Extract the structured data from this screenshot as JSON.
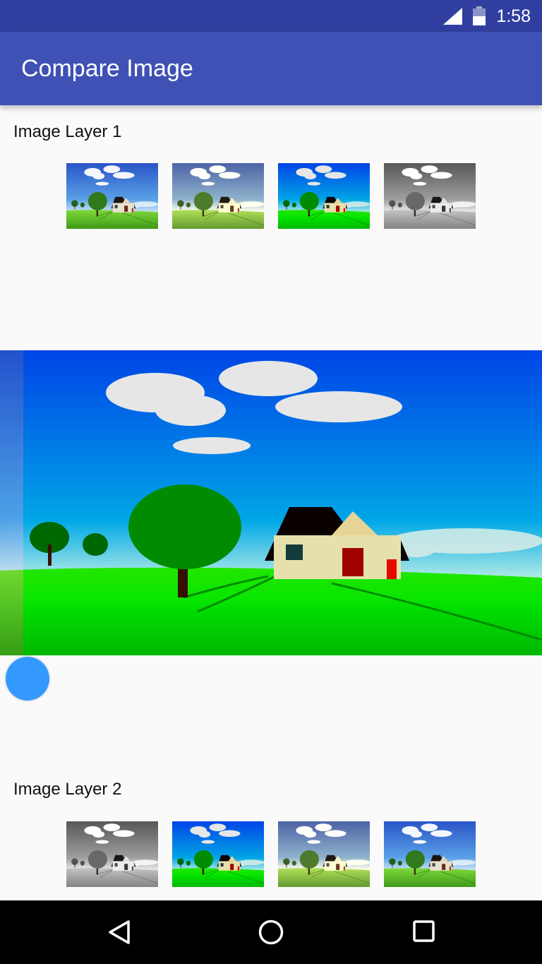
{
  "status_bar": {
    "time": "1:58",
    "icons": [
      "signal-icon",
      "battery-icon"
    ]
  },
  "app_bar": {
    "title": "Compare Image"
  },
  "layer1": {
    "label": "Image Layer 1",
    "thumbnails": [
      "normal",
      "vintage",
      "vivid",
      "grayscale"
    ]
  },
  "layer2": {
    "label": "Image Layer 2",
    "thumbnails": [
      "grayscale",
      "vivid",
      "vintage",
      "normal"
    ]
  },
  "compare": {
    "top_layer": "vivid",
    "bottom_layer": "normal",
    "slider_percent": 4.3
  },
  "colors": {
    "status_bar": "#303f9f",
    "app_bar": "#3f51b5",
    "slider_handle": "#3399ff"
  },
  "nav_bar": {
    "icons": [
      "back-icon",
      "home-icon",
      "recents-icon"
    ]
  }
}
